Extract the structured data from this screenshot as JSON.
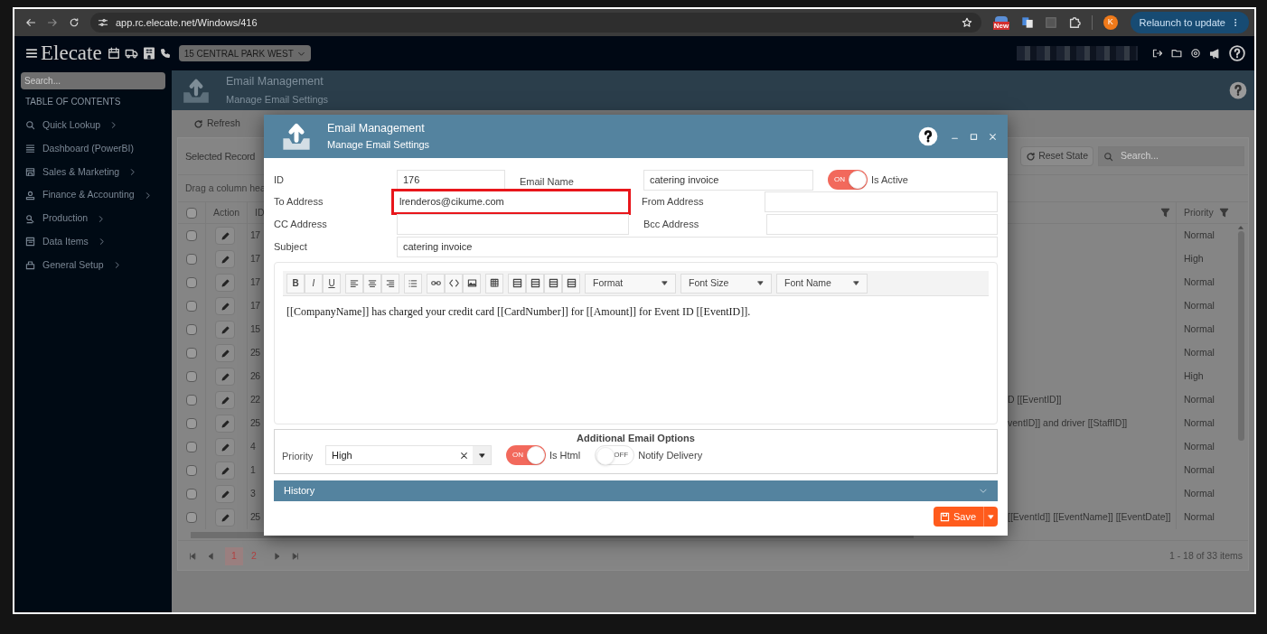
{
  "browser": {
    "url": "app.rc.elecate.net/Windows/416",
    "new_badge": "New",
    "profile_initial": "K",
    "relaunch_button": "Relaunch to update"
  },
  "app_header": {
    "brand": "Elecate",
    "location": "15 CENTRAL PARK WEST"
  },
  "sidebar": {
    "search_placeholder": "Search...",
    "heading": "TABLE OF CONTENTS",
    "items": [
      {
        "label": "Quick Lookup",
        "has_children": true
      },
      {
        "label": "Dashboard (PowerBI)",
        "has_children": false
      },
      {
        "label": "Sales & Marketing",
        "has_children": true
      },
      {
        "label": "Finance & Accounting",
        "has_children": true
      },
      {
        "label": "Production",
        "has_children": true
      },
      {
        "label": "Data Items",
        "has_children": true
      },
      {
        "label": "General Setup",
        "has_children": true
      }
    ]
  },
  "page_header": {
    "title": "Email Management",
    "subtitle": "Manage Email Settings"
  },
  "toolbar": {
    "refresh_button": "Refresh"
  },
  "grid": {
    "title": "Selected Record",
    "reset_button": "Reset State",
    "search_placeholder": "Search...",
    "group_hint": "Drag a column hea",
    "columns": [
      "Action",
      "ID",
      "Priority"
    ],
    "header_checked": false,
    "rows": [
      {
        "checked": false,
        "id": "17",
        "priority": "Normal"
      },
      {
        "checked": false,
        "id": "17",
        "priority": "High"
      },
      {
        "checked": false,
        "id": "17",
        "priority": "Normal"
      },
      {
        "checked": false,
        "id": "17",
        "priority": "Normal"
      },
      {
        "checked": false,
        "id": "15",
        "priority": "Normal"
      },
      {
        "checked": false,
        "id": "25",
        "priority": "Normal"
      },
      {
        "checked": false,
        "id": "26",
        "priority": "High"
      },
      {
        "checked": false,
        "id": "22",
        "text": "D [[EventID]]",
        "priority": "Normal"
      },
      {
        "checked": false,
        "id": "25",
        "text": "ventID]] and driver [[StaffID]]",
        "priority": "Normal"
      },
      {
        "checked": false,
        "id": "4",
        "priority": "Normal"
      },
      {
        "checked": false,
        "id": "1",
        "priority": "Normal"
      },
      {
        "checked": false,
        "id": "3",
        "priority": "Normal"
      },
      {
        "checked": false,
        "id": "25",
        "text": "[[EventId]] [[EventName]] [[EventDate]]",
        "priority": "Normal"
      }
    ],
    "pages": [
      {
        "label": "1",
        "selected": true
      },
      {
        "label": "2",
        "selected": false
      }
    ],
    "item_count": "1 - 18 of 33 items"
  },
  "dialog": {
    "title": "Email Management",
    "subtitle": "Manage Email Settings",
    "id": {
      "label": "ID",
      "value": "176"
    },
    "email_name": {
      "label": "Email Name",
      "value": "catering invoice"
    },
    "is_active": {
      "label": "Is Active",
      "on": true,
      "switch_text": "ON"
    },
    "to_address": {
      "label": "To Address",
      "value": "lrenderos@cikume.com",
      "highlighted": true
    },
    "from_address": {
      "label": "From Address",
      "highlighted": false
    },
    "cc_address": {
      "label": "CC Address",
      "highlighted": false
    },
    "bcc_address": {
      "label": "Bcc Address",
      "highlighted": false
    },
    "subject": {
      "label": "Subject",
      "value": "catering invoice"
    },
    "editor": {
      "format_buttons": [
        "B",
        "I",
        "U"
      ],
      "dropdowns": [
        "Format",
        "Font Size",
        "Font Name"
      ],
      "body": "[[CompanyName]] has charged your credit card [[CardNumber]] for [[Amount]] for Event ID [[EventID]]."
    },
    "options": {
      "heading": "Additional Email Options",
      "priority_label": "Priority",
      "priority_value": "High",
      "switches": [
        {
          "label": "Is Html",
          "on": true,
          "switch_text": "ON"
        },
        {
          "label": "Notify Delivery",
          "on": false,
          "switch_text": "OFF"
        }
      ]
    },
    "history": {
      "label": "History",
      "expanded": false
    },
    "save_button": "Save"
  }
}
